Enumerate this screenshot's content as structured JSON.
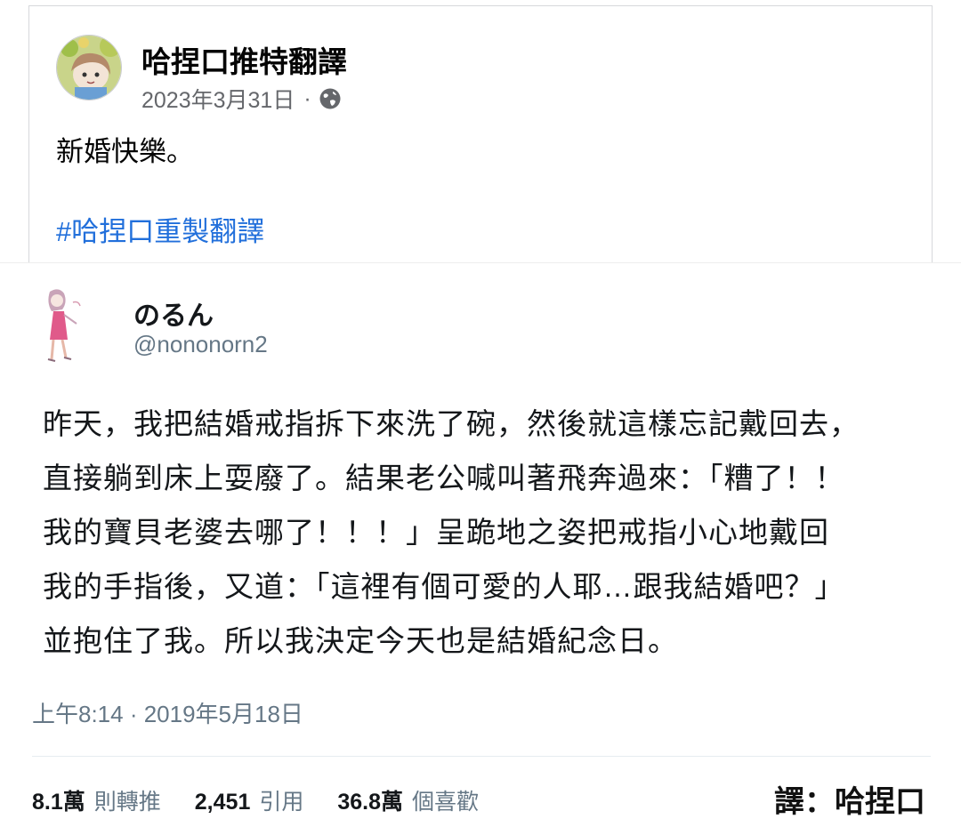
{
  "post": {
    "author": "哈捏口推特翻譯",
    "date": "2023年3月31日",
    "separator": "·",
    "visibility_icon": "globe-icon",
    "text": "新婚快樂。",
    "hashtag": "#哈捏口重製翻譯"
  },
  "tweet": {
    "display_name": "のるん",
    "handle": "@nononorn2",
    "body_lines": [
      "昨天，我把結婚戒指拆下來洗了碗，然後就這樣忘記戴回去，",
      "直接躺到床上耍廢了。結果老公喊叫著飛奔過來：「糟了！！",
      "我的寶貝老婆去哪了！！！」呈跪地之姿把戒指小心地戴回",
      "我的手指後，又道：「這裡有個可愛的人耶…跟我結婚吧？」",
      "並抱住了我。所以我決定今天也是結婚紀念日。"
    ],
    "timestamp": "上午8:14 · 2019年5月18日",
    "stats": {
      "retweets_count": "8.1萬",
      "retweets_label": "則轉推",
      "quotes_count": "2,451",
      "quotes_label": "引用",
      "likes_count": "36.8萬",
      "likes_label": "個喜歡"
    }
  },
  "credit": "譯：哈捏口",
  "colors": {
    "hashtag_link": "#216fdb",
    "secondary_text": "#65676b",
    "tweet_secondary": "#657786"
  }
}
